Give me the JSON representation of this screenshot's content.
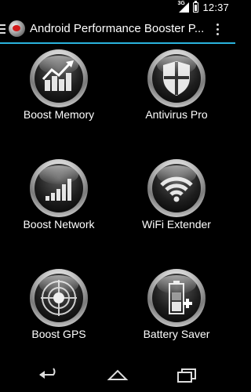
{
  "status": {
    "network": "3G",
    "time": "12:37"
  },
  "action_bar": {
    "title": "Android Performance Booster P..."
  },
  "tiles": [
    {
      "label": "Boost Memory",
      "icon": "bar-chart-up-icon"
    },
    {
      "label": "Antivirus Pro",
      "icon": "shield-icon"
    },
    {
      "label": "Boost Network",
      "icon": "signal-bars-icon"
    },
    {
      "label": "WiFi Extender",
      "icon": "wifi-icon"
    },
    {
      "label": "Boost GPS",
      "icon": "radar-icon"
    },
    {
      "label": "Battery Saver",
      "icon": "battery-charge-icon"
    }
  ],
  "nav": {
    "back": "back-icon",
    "home": "home-icon",
    "recents": "recent-apps-icon"
  },
  "colors": {
    "accent": "#2ab3dd",
    "background": "#000000"
  }
}
